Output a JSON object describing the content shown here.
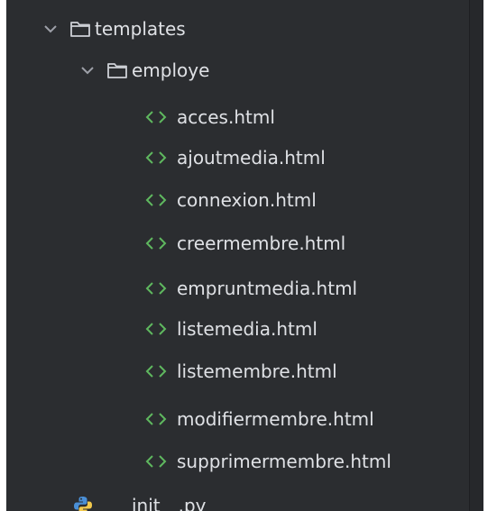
{
  "tree": {
    "folders": [
      {
        "label": "templates",
        "expanded": true,
        "icon": "folder-icon"
      },
      {
        "label": "employe",
        "expanded": true,
        "icon": "folder-icon"
      }
    ],
    "files": [
      {
        "label": "acces.html",
        "icon": "html-file-icon"
      },
      {
        "label": "ajoutmedia.html",
        "icon": "html-file-icon"
      },
      {
        "label": "connexion.html",
        "icon": "html-file-icon"
      },
      {
        "label": "creermembre.html",
        "icon": "html-file-icon"
      },
      {
        "label": "empruntmedia.html",
        "icon": "html-file-icon"
      },
      {
        "label": "listemedia.html",
        "icon": "html-file-icon"
      },
      {
        "label": "listemembre.html",
        "icon": "html-file-icon"
      },
      {
        "label": "modifiermembre.html",
        "icon": "html-file-icon"
      },
      {
        "label": "supprimermembre.html",
        "icon": "html-file-icon"
      }
    ],
    "python_file": {
      "label": "__init__.py",
      "icon": "python-file-icon"
    }
  },
  "colors": {
    "background": "#2b2d30",
    "text": "#dfe1e5",
    "html_icon": "#5fb85f",
    "folder_outline": "#ced0d6"
  }
}
